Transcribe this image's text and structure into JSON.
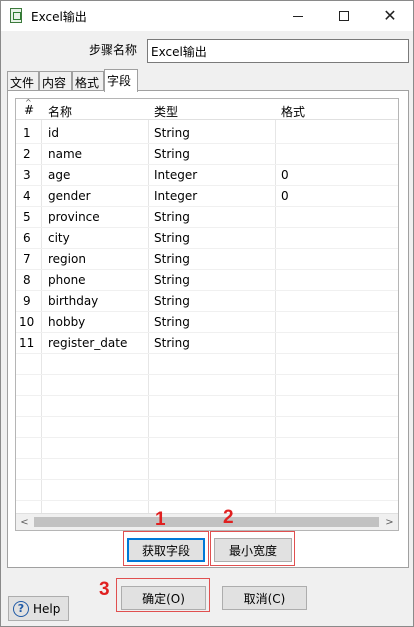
{
  "window": {
    "title": "Excel输出",
    "icon": "excel-output-icon"
  },
  "step": {
    "label": "步骤名称",
    "value": "Excel输出"
  },
  "tabs": [
    {
      "label": "文件"
    },
    {
      "label": "内容"
    },
    {
      "label": "格式"
    },
    {
      "label": "字段",
      "active": true
    }
  ],
  "grid": {
    "headers": {
      "num": "#",
      "name": "名称",
      "type": "类型",
      "format": "格式"
    },
    "rows": [
      {
        "num": "1",
        "name": "id",
        "type": "String",
        "format": ""
      },
      {
        "num": "2",
        "name": "name",
        "type": "String",
        "format": ""
      },
      {
        "num": "3",
        "name": "age",
        "type": "Integer",
        "format": "0"
      },
      {
        "num": "4",
        "name": "gender",
        "type": "Integer",
        "format": "0"
      },
      {
        "num": "5",
        "name": "province",
        "type": "String",
        "format": ""
      },
      {
        "num": "6",
        "name": "city",
        "type": "String",
        "format": ""
      },
      {
        "num": "7",
        "name": "region",
        "type": "String",
        "format": ""
      },
      {
        "num": "8",
        "name": "phone",
        "type": "String",
        "format": ""
      },
      {
        "num": "9",
        "name": "birthday",
        "type": "String",
        "format": ""
      },
      {
        "num": "10",
        "name": "hobby",
        "type": "String",
        "format": ""
      },
      {
        "num": "11",
        "name": "register_date",
        "type": "String",
        "format": ""
      }
    ]
  },
  "buttons": {
    "get_fields": "获取字段",
    "min_width": "最小宽度",
    "ok": "确定(O)",
    "cancel": "取消(C)",
    "help": "Help"
  },
  "annotations": {
    "mark1": "1",
    "mark2": "2",
    "mark3": "3",
    "color": "#e02020"
  }
}
